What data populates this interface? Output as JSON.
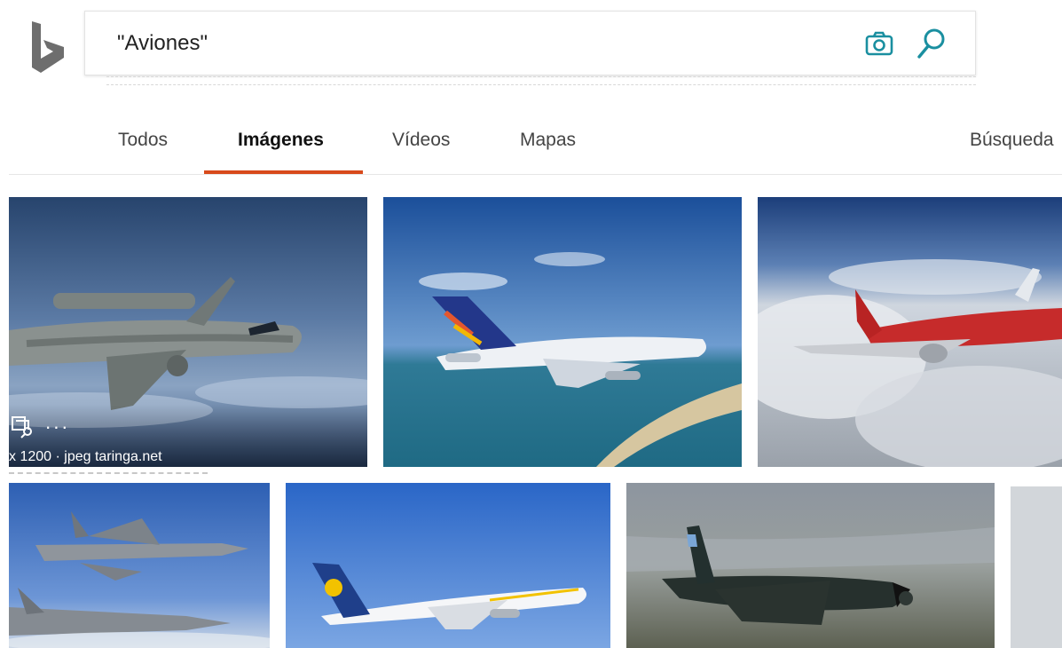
{
  "search": {
    "query": "\"Aviones\""
  },
  "tabs": {
    "todos": "Todos",
    "imagenes": "Imágenes",
    "videos": "Vídeos",
    "mapas": "Mapas",
    "busqueda": "Búsqueda"
  },
  "results": {
    "first_meta": "x 1200 · jpeg  taringa.net",
    "first_more": "···"
  },
  "colors": {
    "accent": "#d84a1b",
    "brand": "#1a8fa0"
  },
  "icons": {
    "camera": "camera-icon",
    "search": "search-icon",
    "visual_search": "visual-search-icon",
    "more": "more-icon"
  }
}
